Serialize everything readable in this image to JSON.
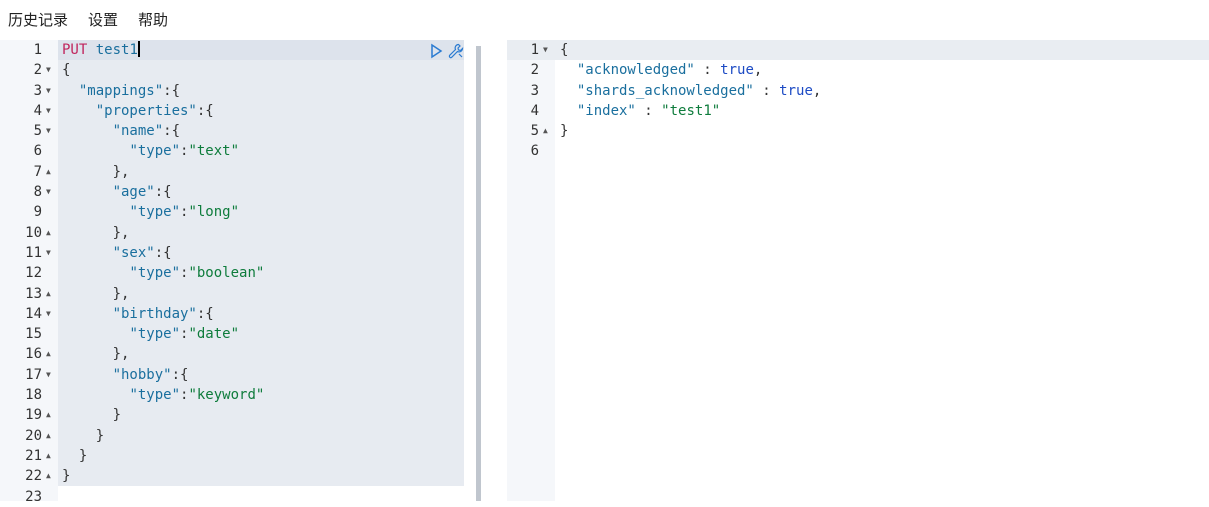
{
  "menu": {
    "items": [
      "历史记录",
      "设置",
      "帮助"
    ]
  },
  "request": {
    "method": "PUT",
    "path": "test1",
    "line_numbers": [
      "1",
      "2",
      "3",
      "4",
      "5",
      "6",
      "7",
      "8",
      "9",
      "10",
      "11",
      "12",
      "13",
      "14",
      "15",
      "16",
      "17",
      "18",
      "19",
      "20",
      "21",
      "22",
      "23"
    ],
    "lines": [
      {
        "tokens": []
      },
      {
        "tokens": [
          {
            "t": "{",
            "c": "pun"
          }
        ]
      },
      {
        "tokens": [
          {
            "t": "  ",
            "c": "pun"
          },
          {
            "t": "\"mappings\"",
            "c": "key"
          },
          {
            "t": ":{",
            "c": "pun"
          }
        ]
      },
      {
        "tokens": [
          {
            "t": "    ",
            "c": "pun"
          },
          {
            "t": "\"properties\"",
            "c": "key"
          },
          {
            "t": ":{",
            "c": "pun"
          }
        ]
      },
      {
        "tokens": [
          {
            "t": "      ",
            "c": "pun"
          },
          {
            "t": "\"name\"",
            "c": "key"
          },
          {
            "t": ":{",
            "c": "pun"
          }
        ]
      },
      {
        "tokens": [
          {
            "t": "        ",
            "c": "pun"
          },
          {
            "t": "\"type\"",
            "c": "key"
          },
          {
            "t": ":",
            "c": "pun"
          },
          {
            "t": "\"text\"",
            "c": "str"
          }
        ]
      },
      {
        "tokens": [
          {
            "t": "      },",
            "c": "pun"
          }
        ]
      },
      {
        "tokens": [
          {
            "t": "      ",
            "c": "pun"
          },
          {
            "t": "\"age\"",
            "c": "key"
          },
          {
            "t": ":{",
            "c": "pun"
          }
        ]
      },
      {
        "tokens": [
          {
            "t": "        ",
            "c": "pun"
          },
          {
            "t": "\"type\"",
            "c": "key"
          },
          {
            "t": ":",
            "c": "pun"
          },
          {
            "t": "\"long\"",
            "c": "str"
          }
        ]
      },
      {
        "tokens": [
          {
            "t": "      },",
            "c": "pun"
          }
        ]
      },
      {
        "tokens": [
          {
            "t": "      ",
            "c": "pun"
          },
          {
            "t": "\"sex\"",
            "c": "key"
          },
          {
            "t": ":{",
            "c": "pun"
          }
        ]
      },
      {
        "tokens": [
          {
            "t": "        ",
            "c": "pun"
          },
          {
            "t": "\"type\"",
            "c": "key"
          },
          {
            "t": ":",
            "c": "pun"
          },
          {
            "t": "\"boolean\"",
            "c": "str"
          }
        ]
      },
      {
        "tokens": [
          {
            "t": "      },",
            "c": "pun"
          }
        ]
      },
      {
        "tokens": [
          {
            "t": "      ",
            "c": "pun"
          },
          {
            "t": "\"birthday\"",
            "c": "key"
          },
          {
            "t": ":{",
            "c": "pun"
          }
        ]
      },
      {
        "tokens": [
          {
            "t": "        ",
            "c": "pun"
          },
          {
            "t": "\"type\"",
            "c": "key"
          },
          {
            "t": ":",
            "c": "pun"
          },
          {
            "t": "\"date\"",
            "c": "str"
          }
        ]
      },
      {
        "tokens": [
          {
            "t": "      },",
            "c": "pun"
          }
        ]
      },
      {
        "tokens": [
          {
            "t": "      ",
            "c": "pun"
          },
          {
            "t": "\"hobby\"",
            "c": "key"
          },
          {
            "t": ":{",
            "c": "pun"
          }
        ]
      },
      {
        "tokens": [
          {
            "t": "        ",
            "c": "pun"
          },
          {
            "t": "\"type\"",
            "c": "key"
          },
          {
            "t": ":",
            "c": "pun"
          },
          {
            "t": "\"keyword\"",
            "c": "str"
          }
        ]
      },
      {
        "tokens": [
          {
            "t": "      }",
            "c": "pun"
          }
        ]
      },
      {
        "tokens": [
          {
            "t": "    }",
            "c": "pun"
          }
        ]
      },
      {
        "tokens": [
          {
            "t": "  }",
            "c": "pun"
          }
        ]
      },
      {
        "tokens": [
          {
            "t": "}",
            "c": "pun"
          }
        ]
      },
      {
        "tokens": []
      }
    ]
  },
  "response": {
    "line_numbers": [
      "1",
      "2",
      "3",
      "4",
      "5",
      "6"
    ],
    "lines": [
      {
        "tokens": [
          {
            "t": "{",
            "c": "pun"
          }
        ]
      },
      {
        "tokens": [
          {
            "t": "  ",
            "c": "pun"
          },
          {
            "t": "\"acknowledged\"",
            "c": "key"
          },
          {
            "t": " : ",
            "c": "pun"
          },
          {
            "t": "true",
            "c": "bool"
          },
          {
            "t": ",",
            "c": "pun"
          }
        ]
      },
      {
        "tokens": [
          {
            "t": "  ",
            "c": "pun"
          },
          {
            "t": "\"shards_acknowledged\"",
            "c": "key"
          },
          {
            "t": " : ",
            "c": "pun"
          },
          {
            "t": "true",
            "c": "bool"
          },
          {
            "t": ",",
            "c": "pun"
          }
        ]
      },
      {
        "tokens": [
          {
            "t": "  ",
            "c": "pun"
          },
          {
            "t": "\"index\"",
            "c": "key"
          },
          {
            "t": " : ",
            "c": "pun"
          },
          {
            "t": "\"test1\"",
            "c": "str"
          }
        ]
      },
      {
        "tokens": [
          {
            "t": "}",
            "c": "pun"
          }
        ]
      },
      {
        "tokens": []
      }
    ]
  },
  "fold_markers": {
    "request": [
      "",
      "down",
      "down",
      "down",
      "down",
      "",
      "up",
      "down",
      "",
      "up",
      "down",
      "",
      "up",
      "down",
      "",
      "up",
      "down",
      "",
      "up",
      "up",
      "up",
      "up",
      ""
    ],
    "response": [
      "down",
      "",
      "",
      "",
      "up",
      ""
    ]
  },
  "icons": {
    "run": "play-icon",
    "settings": "wrench-icon"
  },
  "colors": {
    "method": "#c0245c",
    "key": "#1a6f9e",
    "string": "#0e7c3c",
    "boolean": "#1d4bc4"
  }
}
